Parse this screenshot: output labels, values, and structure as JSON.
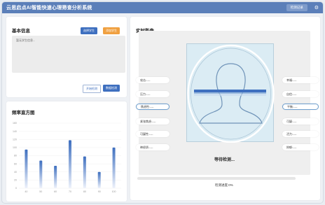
{
  "app": {
    "title": "云思启点AI智能快速心理筛查分析系统",
    "sys_button": "检测记录",
    "settings_icon": "gear-icon"
  },
  "basic_info": {
    "title": "基本信息",
    "select_student": "选择学生",
    "add_student": "添加学生",
    "placeholder": "暂无学生信息...",
    "start_detect": "开始检测",
    "data_detect": "数据检测"
  },
  "histogram": {
    "title": "频率直方图"
  },
  "chart_data": {
    "type": "bar",
    "categories": [
      "40",
      "50",
      "60",
      "70",
      "80",
      "90",
      "100"
    ],
    "values": [
      95,
      68,
      55,
      118,
      78,
      40,
      100
    ],
    "ylim": [
      0,
      160
    ],
    "yticks": [
      "0",
      "20",
      "40",
      "60",
      "80",
      "100",
      "120",
      "140",
      "160"
    ],
    "bar_color_top": "#3e6fbf",
    "bar_color_bottom": "#eef2fb"
  },
  "video": {
    "title": "实时影像",
    "status": "等待检测...",
    "progress_label": "检测进度:0%",
    "progress": 0,
    "accent": "#3e6fbf"
  },
  "metrics_left": [
    {
      "label": "攻击:",
      "value": "----"
    },
    {
      "label": "压力:",
      "value": "----"
    },
    {
      "label": "焦虑性:",
      "value": "----"
    },
    {
      "label": "紧张焦虑:",
      "value": "----"
    },
    {
      "label": "可疑性:",
      "value": "----"
    },
    {
      "label": "神经质:",
      "value": "----"
    }
  ],
  "metrics_right": [
    {
      "label": "幸福:",
      "value": "----"
    },
    {
      "label": "自信:",
      "value": "----"
    },
    {
      "label": "平衡:",
      "value": "----"
    },
    {
      "label": "可疑:",
      "value": "----"
    },
    {
      "label": "活力:",
      "value": "----"
    },
    {
      "label": "抑郁:",
      "value": "----"
    }
  ]
}
